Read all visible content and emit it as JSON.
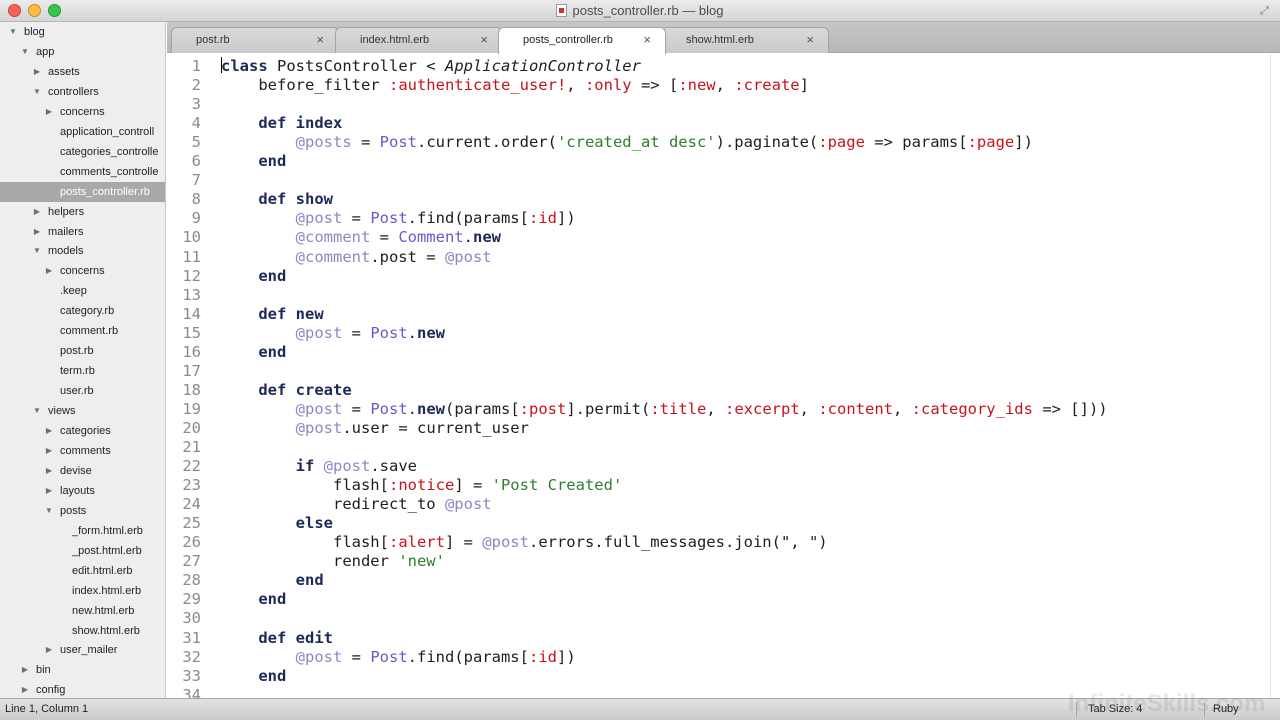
{
  "window": {
    "title": "posts_controller.rb — blog"
  },
  "sidebar": {
    "items": [
      {
        "label": "blog",
        "depth": 0,
        "arrow": "open"
      },
      {
        "label": "app",
        "depth": 1,
        "arrow": "open"
      },
      {
        "label": "assets",
        "depth": 2,
        "arrow": "closed"
      },
      {
        "label": "controllers",
        "depth": 2,
        "arrow": "open"
      },
      {
        "label": "concerns",
        "depth": 3,
        "arrow": "closed"
      },
      {
        "label": "application_controll",
        "depth": 3,
        "arrow": "none"
      },
      {
        "label": "categories_controlle",
        "depth": 3,
        "arrow": "none"
      },
      {
        "label": "comments_controlle",
        "depth": 3,
        "arrow": "none"
      },
      {
        "label": "posts_controller.rb",
        "depth": 3,
        "arrow": "none",
        "selected": true
      },
      {
        "label": "helpers",
        "depth": 2,
        "arrow": "closed"
      },
      {
        "label": "mailers",
        "depth": 2,
        "arrow": "closed"
      },
      {
        "label": "models",
        "depth": 2,
        "arrow": "open"
      },
      {
        "label": "concerns",
        "depth": 3,
        "arrow": "closed"
      },
      {
        "label": ".keep",
        "depth": 3,
        "arrow": "none"
      },
      {
        "label": "category.rb",
        "depth": 3,
        "arrow": "none"
      },
      {
        "label": "comment.rb",
        "depth": 3,
        "arrow": "none"
      },
      {
        "label": "post.rb",
        "depth": 3,
        "arrow": "none"
      },
      {
        "label": "term.rb",
        "depth": 3,
        "arrow": "none"
      },
      {
        "label": "user.rb",
        "depth": 3,
        "arrow": "none"
      },
      {
        "label": "views",
        "depth": 2,
        "arrow": "open"
      },
      {
        "label": "categories",
        "depth": 3,
        "arrow": "closed"
      },
      {
        "label": "comments",
        "depth": 3,
        "arrow": "closed"
      },
      {
        "label": "devise",
        "depth": 3,
        "arrow": "closed"
      },
      {
        "label": "layouts",
        "depth": 3,
        "arrow": "closed"
      },
      {
        "label": "posts",
        "depth": 3,
        "arrow": "open"
      },
      {
        "label": "_form.html.erb",
        "depth": 4,
        "arrow": "none"
      },
      {
        "label": "_post.html.erb",
        "depth": 4,
        "arrow": "none"
      },
      {
        "label": "edit.html.erb",
        "depth": 4,
        "arrow": "none"
      },
      {
        "label": "index.html.erb",
        "depth": 4,
        "arrow": "none"
      },
      {
        "label": "new.html.erb",
        "depth": 4,
        "arrow": "none"
      },
      {
        "label": "show.html.erb",
        "depth": 4,
        "arrow": "none"
      },
      {
        "label": "user_mailer",
        "depth": 3,
        "arrow": "closed"
      },
      {
        "label": "bin",
        "depth": 1,
        "arrow": "closed"
      },
      {
        "label": "config",
        "depth": 1,
        "arrow": "closed"
      }
    ]
  },
  "tabs": [
    {
      "label": "post.rb",
      "active": false,
      "close": "×"
    },
    {
      "label": "index.html.erb",
      "active": false,
      "close": "×"
    },
    {
      "label": "posts_controller.rb",
      "active": true,
      "close": "×"
    },
    {
      "label": "show.html.erb",
      "active": false,
      "close": "×"
    }
  ],
  "editor": {
    "lines": [
      [
        [
          "kw",
          "class"
        ],
        [
          "p",
          " PostsController < "
        ],
        [
          "it",
          "ApplicationController"
        ]
      ],
      [
        [
          "p",
          "    before_filter "
        ],
        [
          "sym",
          ":authenticate_user!"
        ],
        [
          "p",
          ", "
        ],
        [
          "sym",
          ":only"
        ],
        [
          "p",
          " => ["
        ],
        [
          "sym",
          ":new"
        ],
        [
          "p",
          ", "
        ],
        [
          "sym",
          ":create"
        ],
        [
          "p",
          "]"
        ]
      ],
      [],
      [
        [
          "p",
          "    "
        ],
        [
          "kw",
          "def"
        ],
        [
          "p",
          " "
        ],
        [
          "def",
          "index"
        ]
      ],
      [
        [
          "p",
          "        "
        ],
        [
          "ivar",
          "@posts"
        ],
        [
          "p",
          " = "
        ],
        [
          "const",
          "Post"
        ],
        [
          "p",
          ".current.order("
        ],
        [
          "str",
          "'created_at desc'"
        ],
        [
          "p",
          ").paginate("
        ],
        [
          "sym",
          ":page"
        ],
        [
          "p",
          " => params["
        ],
        [
          "sym",
          ":page"
        ],
        [
          "p",
          "])"
        ]
      ],
      [
        [
          "p",
          "    "
        ],
        [
          "kw",
          "end"
        ]
      ],
      [],
      [
        [
          "p",
          "    "
        ],
        [
          "kw",
          "def"
        ],
        [
          "p",
          " "
        ],
        [
          "def",
          "show"
        ]
      ],
      [
        [
          "p",
          "        "
        ],
        [
          "ivar",
          "@post"
        ],
        [
          "p",
          " = "
        ],
        [
          "const",
          "Post"
        ],
        [
          "p",
          ".find(params["
        ],
        [
          "sym",
          ":id"
        ],
        [
          "p",
          "])"
        ]
      ],
      [
        [
          "p",
          "        "
        ],
        [
          "ivar",
          "@comment"
        ],
        [
          "p",
          " = "
        ],
        [
          "const",
          "Comment"
        ],
        [
          "p",
          "."
        ],
        [
          "kw",
          "new"
        ]
      ],
      [
        [
          "p",
          "        "
        ],
        [
          "ivar",
          "@comment"
        ],
        [
          "p",
          ".post = "
        ],
        [
          "ivar",
          "@post"
        ]
      ],
      [
        [
          "p",
          "    "
        ],
        [
          "kw",
          "end"
        ]
      ],
      [],
      [
        [
          "p",
          "    "
        ],
        [
          "kw",
          "def"
        ],
        [
          "p",
          " "
        ],
        [
          "def",
          "new"
        ]
      ],
      [
        [
          "p",
          "        "
        ],
        [
          "ivar",
          "@post"
        ],
        [
          "p",
          " = "
        ],
        [
          "const",
          "Post"
        ],
        [
          "p",
          "."
        ],
        [
          "kw",
          "new"
        ]
      ],
      [
        [
          "p",
          "    "
        ],
        [
          "kw",
          "end"
        ]
      ],
      [],
      [
        [
          "p",
          "    "
        ],
        [
          "kw",
          "def"
        ],
        [
          "p",
          " "
        ],
        [
          "def",
          "create"
        ]
      ],
      [
        [
          "p",
          "        "
        ],
        [
          "ivar",
          "@post"
        ],
        [
          "p",
          " = "
        ],
        [
          "const",
          "Post"
        ],
        [
          "p",
          "."
        ],
        [
          "kw",
          "new"
        ],
        [
          "p",
          "(params["
        ],
        [
          "sym",
          ":post"
        ],
        [
          "p",
          "].permit("
        ],
        [
          "sym",
          ":title"
        ],
        [
          "p",
          ", "
        ],
        [
          "sym",
          ":excerpt"
        ],
        [
          "p",
          ", "
        ],
        [
          "sym",
          ":content"
        ],
        [
          "p",
          ", "
        ],
        [
          "sym",
          ":category_ids"
        ],
        [
          "p",
          " => []))"
        ]
      ],
      [
        [
          "p",
          "        "
        ],
        [
          "ivar",
          "@post"
        ],
        [
          "p",
          ".user = current_user"
        ]
      ],
      [],
      [
        [
          "p",
          "        "
        ],
        [
          "kw",
          "if"
        ],
        [
          "p",
          " "
        ],
        [
          "ivar",
          "@post"
        ],
        [
          "p",
          ".save"
        ]
      ],
      [
        [
          "p",
          "            flash["
        ],
        [
          "sym",
          ":notice"
        ],
        [
          "p",
          "] = "
        ],
        [
          "str",
          "'Post Created'"
        ]
      ],
      [
        [
          "p",
          "            redirect_to "
        ],
        [
          "ivar",
          "@post"
        ]
      ],
      [
        [
          "p",
          "        "
        ],
        [
          "kw",
          "else"
        ]
      ],
      [
        [
          "p",
          "            flash["
        ],
        [
          "sym",
          ":alert"
        ],
        [
          "p",
          "] = "
        ],
        [
          "ivar",
          "@post"
        ],
        [
          "p",
          ".errors.full_messages.join(\", \")"
        ]
      ],
      [
        [
          "p",
          "            render "
        ],
        [
          "str",
          "'new'"
        ]
      ],
      [
        [
          "p",
          "        "
        ],
        [
          "kw",
          "end"
        ]
      ],
      [
        [
          "p",
          "    "
        ],
        [
          "kw",
          "end"
        ]
      ],
      [],
      [
        [
          "p",
          "    "
        ],
        [
          "kw",
          "def"
        ],
        [
          "p",
          " "
        ],
        [
          "def",
          "edit"
        ]
      ],
      [
        [
          "p",
          "        "
        ],
        [
          "ivar",
          "@post"
        ],
        [
          "p",
          " = "
        ],
        [
          "const",
          "Post"
        ],
        [
          "p",
          ".find(params["
        ],
        [
          "sym",
          ":id"
        ],
        [
          "p",
          "])"
        ]
      ],
      [
        [
          "p",
          "    "
        ],
        [
          "kw",
          "end"
        ]
      ],
      []
    ]
  },
  "status": {
    "position": "Line 1, Column 1",
    "tab_size": "Tab Size: 4",
    "syntax": "Ruby",
    "watermark": "InfiniteSkills.com"
  },
  "colors": {
    "keyword": "#1c2a57",
    "constant": "#6a57c8",
    "instance_variable": "#8c88c4",
    "symbol": "#c6141c",
    "string": "#2e7e2e",
    "selection": "#a9a9a9"
  }
}
